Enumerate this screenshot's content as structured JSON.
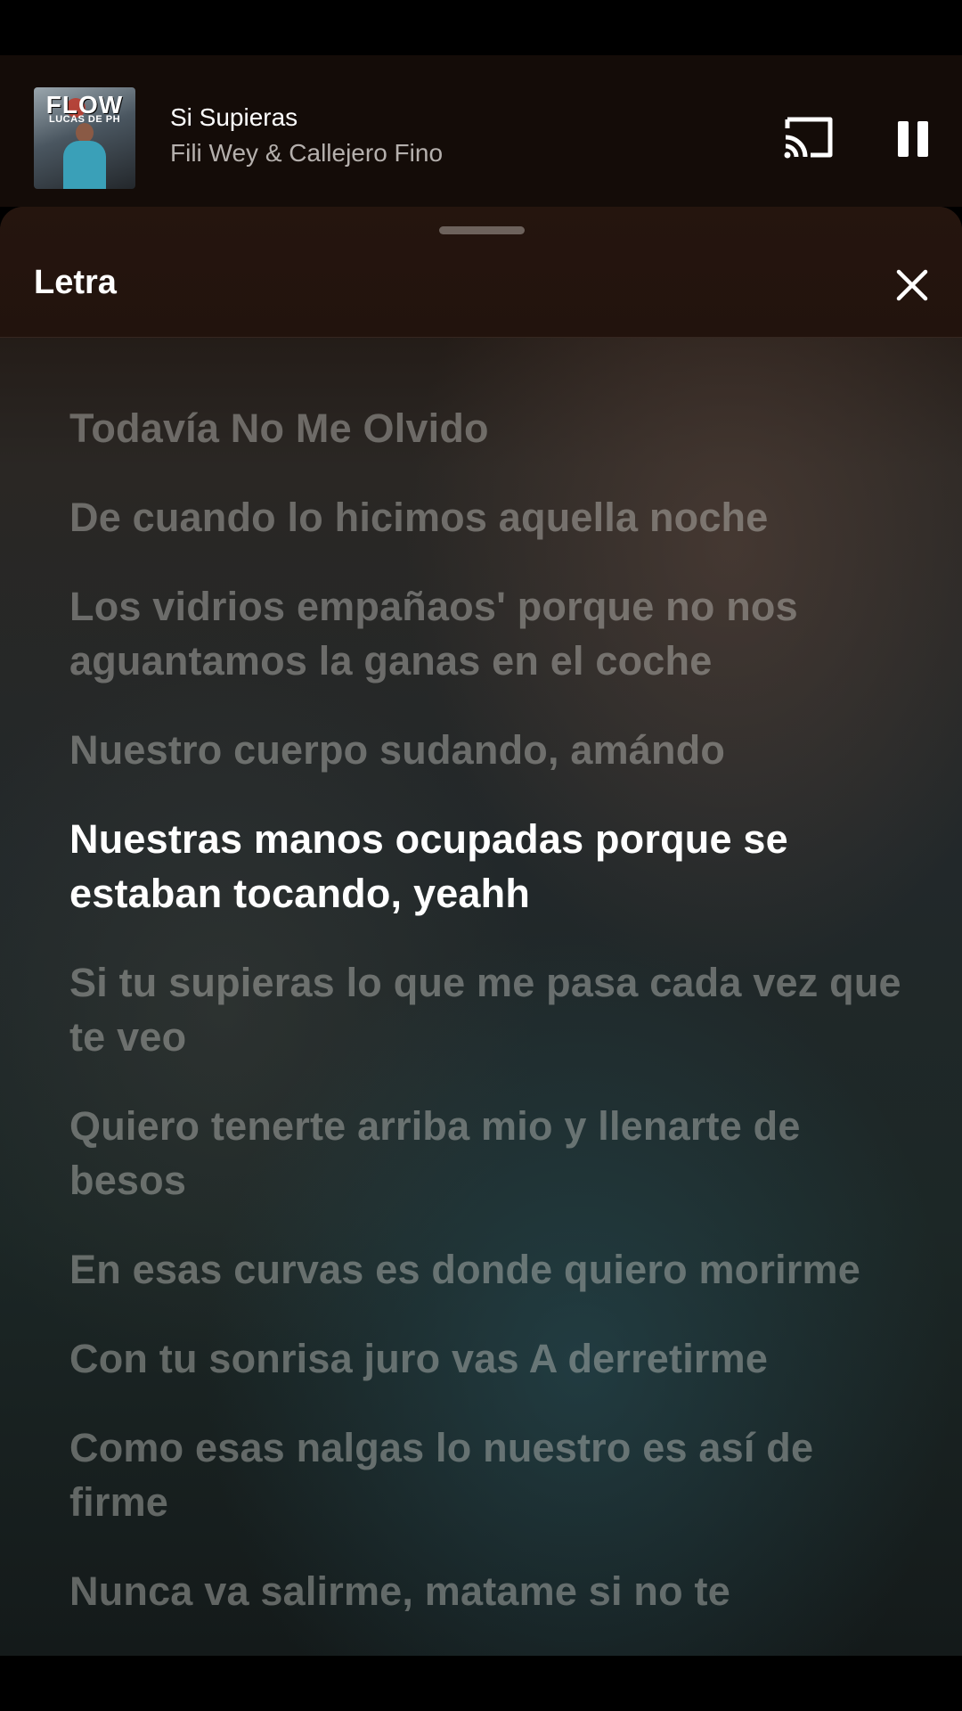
{
  "mini_player": {
    "album_art": {
      "text": "FLOW",
      "subtext": "LUCAS DE PH"
    },
    "track_title": "Si Supieras",
    "track_artist": "Fili Wey & Callejero Fino",
    "icons": {
      "cast": "cast-icon",
      "pause": "pause-icon"
    }
  },
  "lyrics_sheet": {
    "title": "Letra",
    "close_icon": "close-icon",
    "active_index": 4,
    "lines": [
      "Todavía No Me Olvido",
      "De cuando lo hicimos aquella noche",
      "Los vidrios empañaos' porque no nos aguantamos la ganas en el coche",
      "Nuestro cuerpo sudando, amándo",
      "Nuestras manos ocupadas porque se estaban tocando, yeahh",
      "Si tu supieras lo que me pasa cada vez que te veo",
      "Quiero tenerte arriba mio y llenarte de besos",
      "En esas curvas es donde quiero morirme",
      "Con tu sonrisa juro vas A derretirme",
      "Como esas nalgas lo nuestro es así de firme",
      "Nunca va salirme, matame si no te"
    ]
  },
  "colors": {
    "active_lyric": "#ffffff",
    "inactive_lyric": "rgba(205,205,200,0.42)",
    "header_bg": "#22130d"
  }
}
